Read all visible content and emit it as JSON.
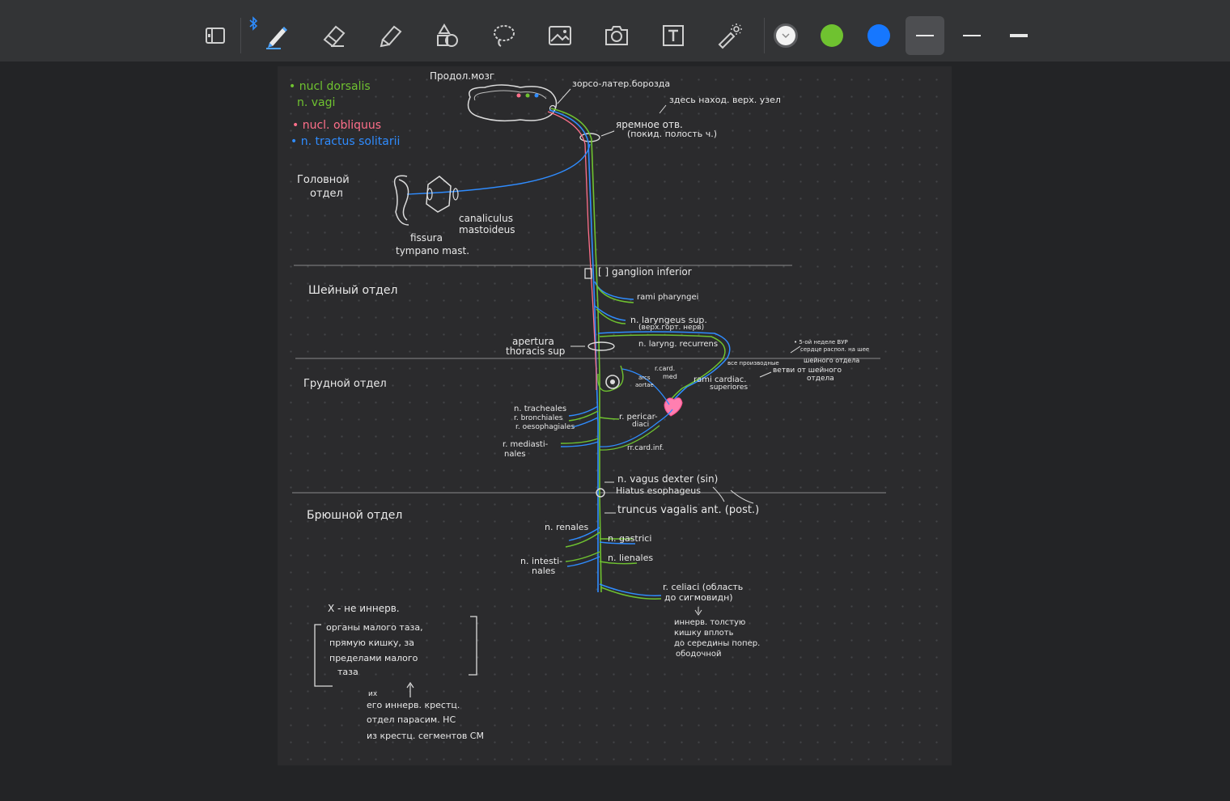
{
  "toolbar": {
    "tools": [
      {
        "name": "sidebar-toggle",
        "icon": "sidebar-icon"
      },
      {
        "name": "pen",
        "icon": "pen-icon"
      },
      {
        "name": "eraser",
        "icon": "eraser-icon"
      },
      {
        "name": "highlighter",
        "icon": "highlighter-icon"
      },
      {
        "name": "shapes",
        "icon": "shapes-icon"
      },
      {
        "name": "lasso",
        "icon": "lasso-icon"
      },
      {
        "name": "image",
        "icon": "image-icon"
      },
      {
        "name": "camera",
        "icon": "camera-icon"
      },
      {
        "name": "text",
        "icon": "text-box-icon"
      },
      {
        "name": "laser-pointer",
        "icon": "laser-pointer-icon"
      }
    ],
    "bluetooth_icon": "bluetooth-icon",
    "colors": {
      "white": "#f2f2f2",
      "green": "#6fc230",
      "blue": "#1677ff"
    },
    "selected_color": "white",
    "selected_stroke": "thin"
  },
  "note": {
    "legend": {
      "dorsalis": "• nucl dorsalis",
      "vagi": "n. vagi",
      "obliquus": "• nucl. obliquus",
      "solitarii": "• n. tractus solitarii"
    },
    "brainstem_label": "Продол.мозг",
    "groove_label": "зорсо-латер.борозда",
    "ganglion_sup": "здесь наход. верх. узел",
    "jugular_foramen": "яремное отв.",
    "jugular_foramen_sub": "(покид. полость ч.)",
    "head_section": [
      "Головной",
      "отдел"
    ],
    "canaliculus": [
      "canaliculus",
      "mastoideus"
    ],
    "fissura": [
      "fissura",
      "tympano mast."
    ],
    "ganglion_inf": "[ ] ganglion inferior",
    "neck_section": "Шейный отдел",
    "rami_pharyngei": "rami pharyngei",
    "laryngeus_sup": "n. laryngeus sup.",
    "laryngeus_sup_note": "(верх.горт. нерв)",
    "apertura": [
      "apertura",
      "thoracis sup"
    ],
    "laryng_recurrens": "n. laryng. recurrens",
    "heart_note_1": "• 5-ой неделе ВУР",
    "heart_note_2": "сердце распол. на шее",
    "heart_note_3": "все производные",
    "heart_note_4": "шейного отдела",
    "heart_note_5": "ветви от шейного",
    "heart_note_6": "отдела",
    "thorax_section": "Грудной отдел",
    "rcard_med": [
      "r.card.",
      "med"
    ],
    "aorta": [
      "arcs",
      "aortae"
    ],
    "rami_cardiaci": [
      "rami cardiac.",
      "superiores"
    ],
    "tracheales": [
      "n. tracheales",
      "r. bronchiales",
      "r. oesophagiales"
    ],
    "pericardiaci": [
      "r. pericar-",
      "diaci"
    ],
    "mediastinales": [
      "r. mediasti-",
      "nales"
    ],
    "rcard_inf": "rr.card.inf.",
    "vagus_dexter": "n. vagus dexter (sin)",
    "hiatus": "Hiatus esophageus",
    "abdomen_section": "Брюшной отдел",
    "truncus": "truncus vagalis ant. (post.)",
    "renales": "n. renales",
    "gastrici": "n. gastrici",
    "intestinales": [
      "n. intesti-",
      "nales"
    ],
    "lienales": "n. lienales",
    "coeliaci": [
      "r. celiaci (область",
      "до сигмовидн)"
    ],
    "colon_note": [
      "иннерв. толстую",
      "кишку вплоть",
      "до середины попер.",
      "ободочной"
    ],
    "x_note": "X - не иннерв.",
    "bracket_note": [
      "органы малого таза,",
      "прямую кишку, за",
      "пределами малого",
      "таза"
    ],
    "bottom_note_ix": "их",
    "bottom_note": [
      "его иннерв. крестц.",
      "отдел парасим. НС",
      "из крестц. сегментов СМ"
    ]
  }
}
